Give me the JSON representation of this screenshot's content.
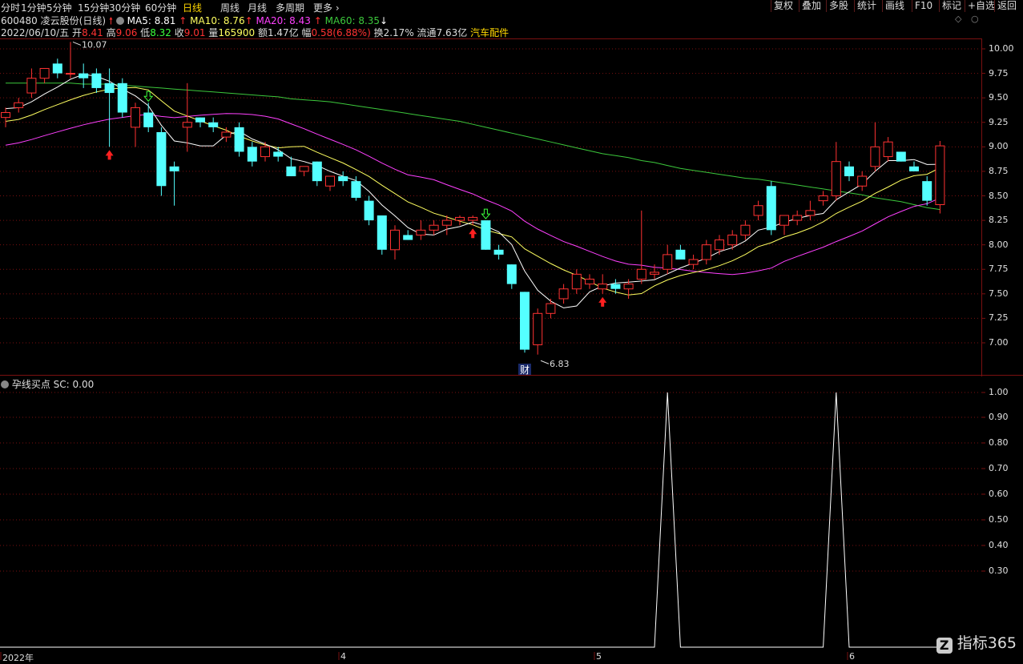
{
  "toolbar": {
    "periods": [
      "分时",
      "1分钟",
      "5分钟",
      "15分钟",
      "30分钟",
      "60分钟",
      "日线",
      "周线",
      "月线",
      "多周期",
      "更多"
    ],
    "active_period": "日线",
    "right_buttons": [
      "复权",
      "叠加",
      "多股",
      "统计",
      "画线",
      "F10",
      "标记",
      "+自选",
      "返回"
    ]
  },
  "stock": {
    "code": "600480",
    "name": "凌云股份",
    "period_label": "(日线)",
    "date": "2022/06/10/五",
    "open_label": "开",
    "open": "8.41",
    "high_label": "高",
    "high": "9.06",
    "low_label": "低",
    "low": "8.32",
    "close_label": "收",
    "close": "9.01",
    "volume_label": "量",
    "volume": "165900",
    "amount_label": "额",
    "amount": "1.47亿",
    "change_label": "幅",
    "change": "0.58(6.88%)",
    "turnover_label": "换",
    "turnover": "2.17%",
    "float_label": "流通",
    "float_cap": "7.63亿",
    "sector": "汽车配件"
  },
  "ma": {
    "ma5": "MA5: 8.81",
    "ma10": "MA10: 8.76",
    "ma20": "MA20: 8.43",
    "ma60": "MA60: 8.35"
  },
  "colors": {
    "up": "#ff3232",
    "down": "#54ffff",
    "ma5": "#ffffff",
    "ma10": "#ffff60",
    "ma20": "#ff40ff",
    "ma60": "#3cc83c",
    "grid": "#7a1010"
  },
  "annotations": {
    "high_marker": "10.07",
    "low_marker": "6.83",
    "finance_badge": "财"
  },
  "indicator": {
    "name": "孕线买点",
    "readout": "SC: 0.00"
  },
  "x_axis": {
    "labels": [
      "2022年",
      "4",
      "5",
      "6"
    ]
  },
  "watermark": "指标365",
  "chart_data": [
    {
      "type": "candlestick",
      "title": "凌云股份 (日线)",
      "y_axis": {
        "ticks": [
          7.0,
          7.25,
          7.5,
          7.75,
          8.0,
          8.25,
          8.5,
          8.75,
          9.0,
          9.25,
          9.5,
          9.75,
          10.0
        ],
        "range": [
          6.8,
          10.1
        ]
      },
      "candles": [
        [
          9.3,
          9.4,
          9.2,
          9.35
        ],
        [
          9.4,
          9.5,
          9.35,
          9.45
        ],
        [
          9.55,
          9.8,
          9.5,
          9.7
        ],
        [
          9.7,
          9.8,
          9.65,
          9.8
        ],
        [
          9.85,
          9.9,
          9.7,
          9.75
        ],
        [
          9.75,
          10.07,
          9.7,
          9.75
        ],
        [
          9.75,
          9.85,
          9.6,
          9.7
        ],
        [
          9.75,
          9.8,
          9.55,
          9.6
        ],
        [
          9.65,
          9.8,
          9.0,
          9.55
        ],
        [
          9.65,
          9.7,
          9.3,
          9.35
        ],
        [
          9.2,
          9.45,
          9.0,
          9.4
        ],
        [
          9.35,
          9.45,
          9.15,
          9.2
        ],
        [
          9.15,
          9.2,
          8.5,
          8.6
        ],
        [
          8.8,
          8.85,
          8.4,
          8.75
        ],
        [
          9.2,
          9.65,
          8.95,
          9.25
        ],
        [
          9.3,
          9.3,
          9.2,
          9.25
        ],
        [
          9.25,
          9.3,
          9.15,
          9.2
        ],
        [
          9.1,
          9.2,
          9.05,
          9.15
        ],
        [
          9.2,
          9.25,
          8.9,
          8.95
        ],
        [
          9.0,
          9.05,
          8.8,
          8.85
        ],
        [
          8.9,
          9.05,
          8.85,
          9.0
        ],
        [
          8.95,
          9.0,
          8.85,
          8.9
        ],
        [
          8.8,
          8.9,
          8.7,
          8.7
        ],
        [
          8.75,
          8.8,
          8.7,
          8.8
        ],
        [
          8.85,
          8.85,
          8.6,
          8.65
        ],
        [
          8.6,
          8.7,
          8.55,
          8.7
        ],
        [
          8.7,
          8.75,
          8.6,
          8.65
        ],
        [
          8.65,
          8.7,
          8.45,
          8.48
        ],
        [
          8.45,
          8.5,
          8.2,
          8.25
        ],
        [
          8.3,
          8.3,
          7.9,
          7.95
        ],
        [
          7.95,
          8.2,
          7.85,
          8.15
        ],
        [
          8.1,
          8.15,
          8.05,
          8.05
        ],
        [
          8.1,
          8.25,
          8.05,
          8.15
        ],
        [
          8.15,
          8.25,
          8.1,
          8.2
        ],
        [
          8.2,
          8.3,
          8.1,
          8.25
        ],
        [
          8.25,
          8.3,
          8.2,
          8.28
        ],
        [
          8.25,
          8.3,
          8.2,
          8.28
        ],
        [
          8.25,
          8.25,
          7.95,
          7.95
        ],
        [
          7.95,
          8.0,
          7.85,
          7.9
        ],
        [
          7.8,
          7.8,
          7.55,
          7.6
        ],
        [
          7.52,
          7.52,
          6.9,
          6.93
        ],
        [
          6.98,
          7.35,
          6.88,
          7.3
        ],
        [
          7.3,
          7.45,
          7.25,
          7.4
        ],
        [
          7.45,
          7.6,
          7.4,
          7.55
        ],
        [
          7.55,
          7.75,
          7.5,
          7.7
        ],
        [
          7.6,
          7.7,
          7.55,
          7.65
        ],
        [
          7.55,
          7.7,
          7.5,
          7.6
        ],
        [
          7.6,
          7.65,
          7.5,
          7.55
        ],
        [
          7.55,
          7.65,
          7.45,
          7.6
        ],
        [
          7.65,
          8.35,
          7.6,
          7.75
        ],
        [
          7.7,
          7.8,
          7.65,
          7.72
        ],
        [
          7.75,
          8.0,
          7.7,
          7.9
        ],
        [
          7.95,
          8.0,
          7.85,
          7.85
        ],
        [
          7.8,
          7.9,
          7.75,
          7.85
        ],
        [
          7.85,
          8.05,
          7.8,
          8.0
        ],
        [
          7.95,
          8.1,
          7.9,
          8.05
        ],
        [
          8.0,
          8.15,
          7.95,
          8.1
        ],
        [
          8.1,
          8.25,
          8.05,
          8.2
        ],
        [
          8.3,
          8.45,
          8.25,
          8.4
        ],
        [
          8.6,
          8.65,
          8.1,
          8.15
        ],
        [
          8.2,
          8.3,
          8.1,
          8.3
        ],
        [
          8.25,
          8.35,
          8.2,
          8.3
        ],
        [
          8.3,
          8.45,
          8.25,
          8.35
        ],
        [
          8.45,
          8.55,
          8.4,
          8.5
        ],
        [
          8.5,
          9.05,
          8.45,
          8.85
        ],
        [
          8.8,
          8.85,
          8.65,
          8.7
        ],
        [
          8.6,
          8.75,
          8.55,
          8.7
        ],
        [
          8.8,
          9.25,
          8.75,
          9.0
        ],
        [
          8.9,
          9.1,
          8.85,
          9.05
        ],
        [
          8.95,
          8.95,
          8.85,
          8.85
        ],
        [
          8.8,
          8.85,
          8.75,
          8.75
        ],
        [
          8.65,
          8.7,
          8.4,
          8.45
        ],
        [
          8.41,
          9.06,
          8.32,
          9.01
        ]
      ],
      "markers": [
        {
          "type": "buy_arrow",
          "index": 8
        },
        {
          "type": "sell_arrow",
          "index": 11
        },
        {
          "type": "buy_arrow",
          "index": 36
        },
        {
          "type": "sell_arrow",
          "index": 37
        },
        {
          "type": "buy_arrow",
          "index": 46
        }
      ],
      "ma60": [
        9.65,
        9.65,
        9.65,
        9.65,
        9.65,
        9.65,
        9.64,
        9.64,
        9.64,
        9.63,
        9.62,
        9.61,
        9.6,
        9.59,
        9.58,
        9.57,
        9.56,
        9.55,
        9.54,
        9.53,
        9.52,
        9.51,
        9.49,
        9.48,
        9.47,
        9.46,
        9.44,
        9.42,
        9.4,
        9.38,
        9.36,
        9.34,
        9.32,
        9.3,
        9.28,
        9.26,
        9.23,
        9.2,
        9.17,
        9.14,
        9.11,
        9.08,
        9.05,
        9.02,
        8.99,
        8.96,
        8.93,
        8.91,
        8.89,
        8.86,
        8.84,
        8.81,
        8.78,
        8.76,
        8.74,
        8.72,
        8.7,
        8.68,
        8.67,
        8.65,
        8.63,
        8.61,
        8.59,
        8.57,
        8.55,
        8.53,
        8.51,
        8.48,
        8.46,
        8.44,
        8.41,
        8.38,
        8.36
      ]
    },
    {
      "type": "line",
      "title": "孕线买点",
      "y_axis": {
        "ticks": [
          1.0,
          0.9,
          0.8,
          0.7,
          0.6,
          0.5,
          0.4,
          0.3
        ]
      },
      "signal_indices": [
        51,
        64
      ],
      "values_note": "SC is 0 on every day except the two signal days where it equals 1.00"
    }
  ]
}
